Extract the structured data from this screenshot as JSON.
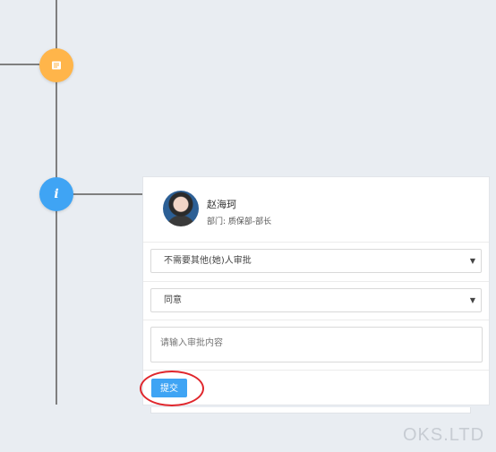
{
  "timeline": {
    "nodes": [
      {
        "icon": "document-icon",
        "color": "#ffb54a"
      },
      {
        "icon": "info-icon",
        "label": "i",
        "color": "#3fa4f4"
      }
    ]
  },
  "approval_card": {
    "user": {
      "name": "赵海珂",
      "department": "部门: 质保部-部长"
    },
    "next_approver_select": {
      "value": "不需要其他(她)人审批"
    },
    "decision_select": {
      "value": "同意"
    },
    "comment": {
      "placeholder": "请输入审批内容"
    },
    "submit_label": "提交"
  },
  "annotation": {
    "color": "#e0262c"
  },
  "watermark": "OKS.LTD",
  "colors": {
    "accent": "#3fa4f4",
    "doc_node": "#ffb54a",
    "background": "#e9edf2"
  }
}
